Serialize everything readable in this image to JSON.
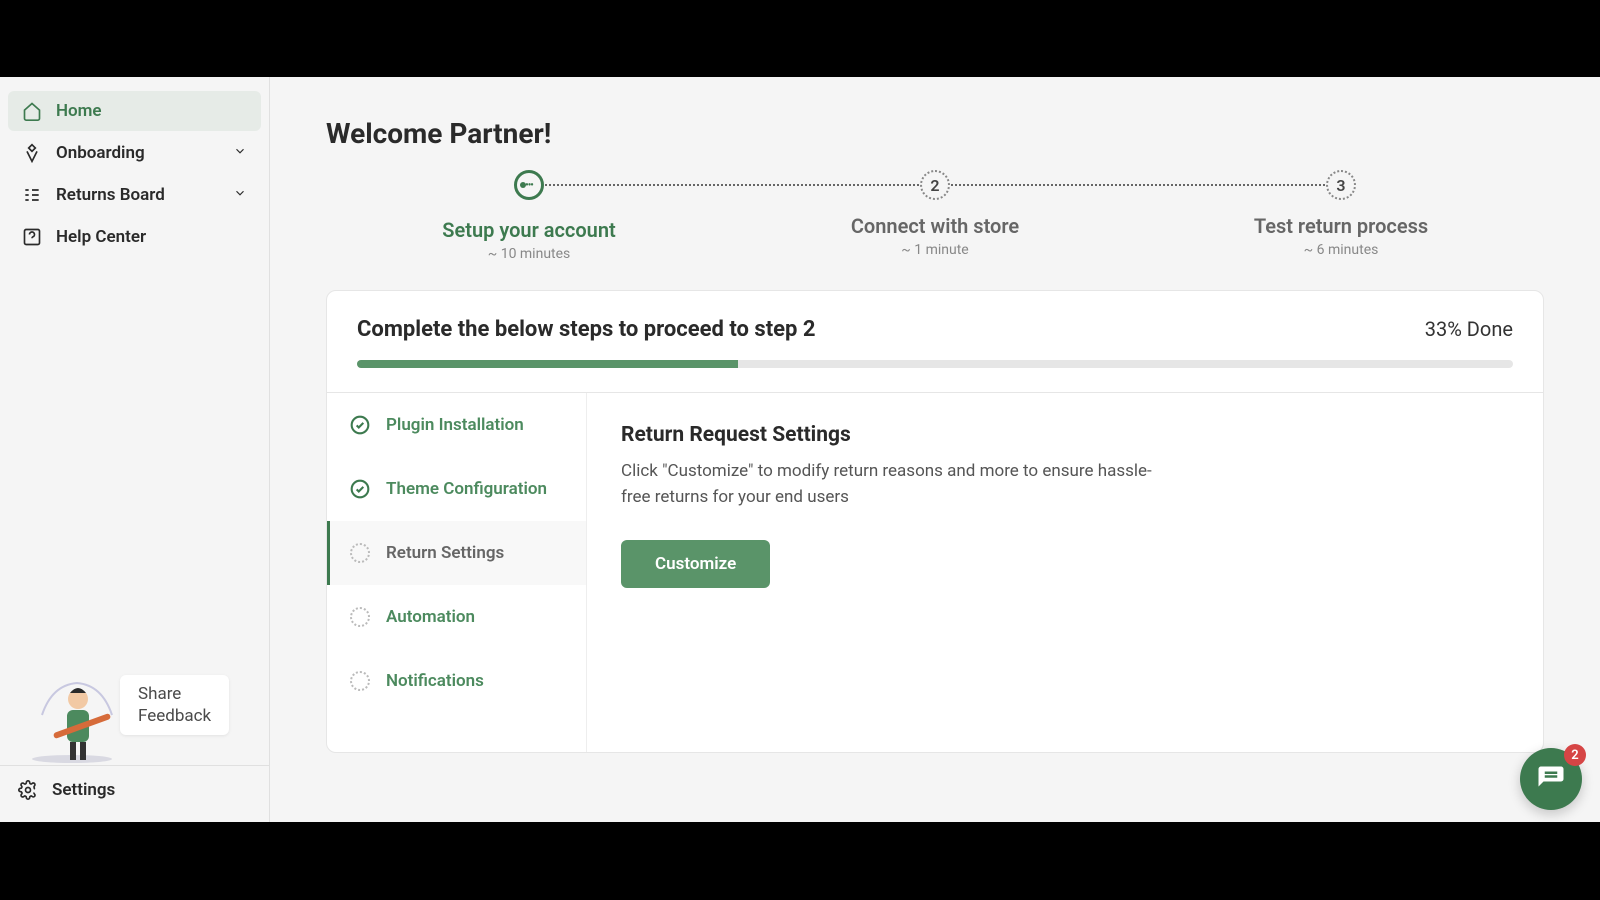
{
  "sidebar": {
    "items": [
      {
        "label": "Home"
      },
      {
        "label": "Onboarding"
      },
      {
        "label": "Returns Board"
      },
      {
        "label": "Help Center"
      }
    ],
    "feedback_line1": "Share",
    "feedback_line2": "Feedback",
    "settings_label": "Settings"
  },
  "main": {
    "welcome": "Welcome Partner!",
    "steps": [
      {
        "title": "Setup your account",
        "sub": "~ 10 minutes"
      },
      {
        "title": "Connect with store",
        "sub": "~ 1 minute",
        "num": "2"
      },
      {
        "title": "Test return process",
        "sub": "~ 6 minutes",
        "num": "3"
      }
    ],
    "card_title": "Complete the below steps to proceed to step 2",
    "progress_label": "33% Done",
    "progress_percent": 33,
    "tasks": [
      {
        "label": "Plugin Installation"
      },
      {
        "label": "Theme Configuration"
      },
      {
        "label": "Return Settings"
      },
      {
        "label": "Automation"
      },
      {
        "label": "Notifications"
      }
    ],
    "detail": {
      "title": "Return Request Settings",
      "desc": "Click \"Customize\" to modify return reasons and more to ensure hassle-free returns for your end users",
      "button": "Customize"
    }
  },
  "chat": {
    "badge": "2"
  }
}
